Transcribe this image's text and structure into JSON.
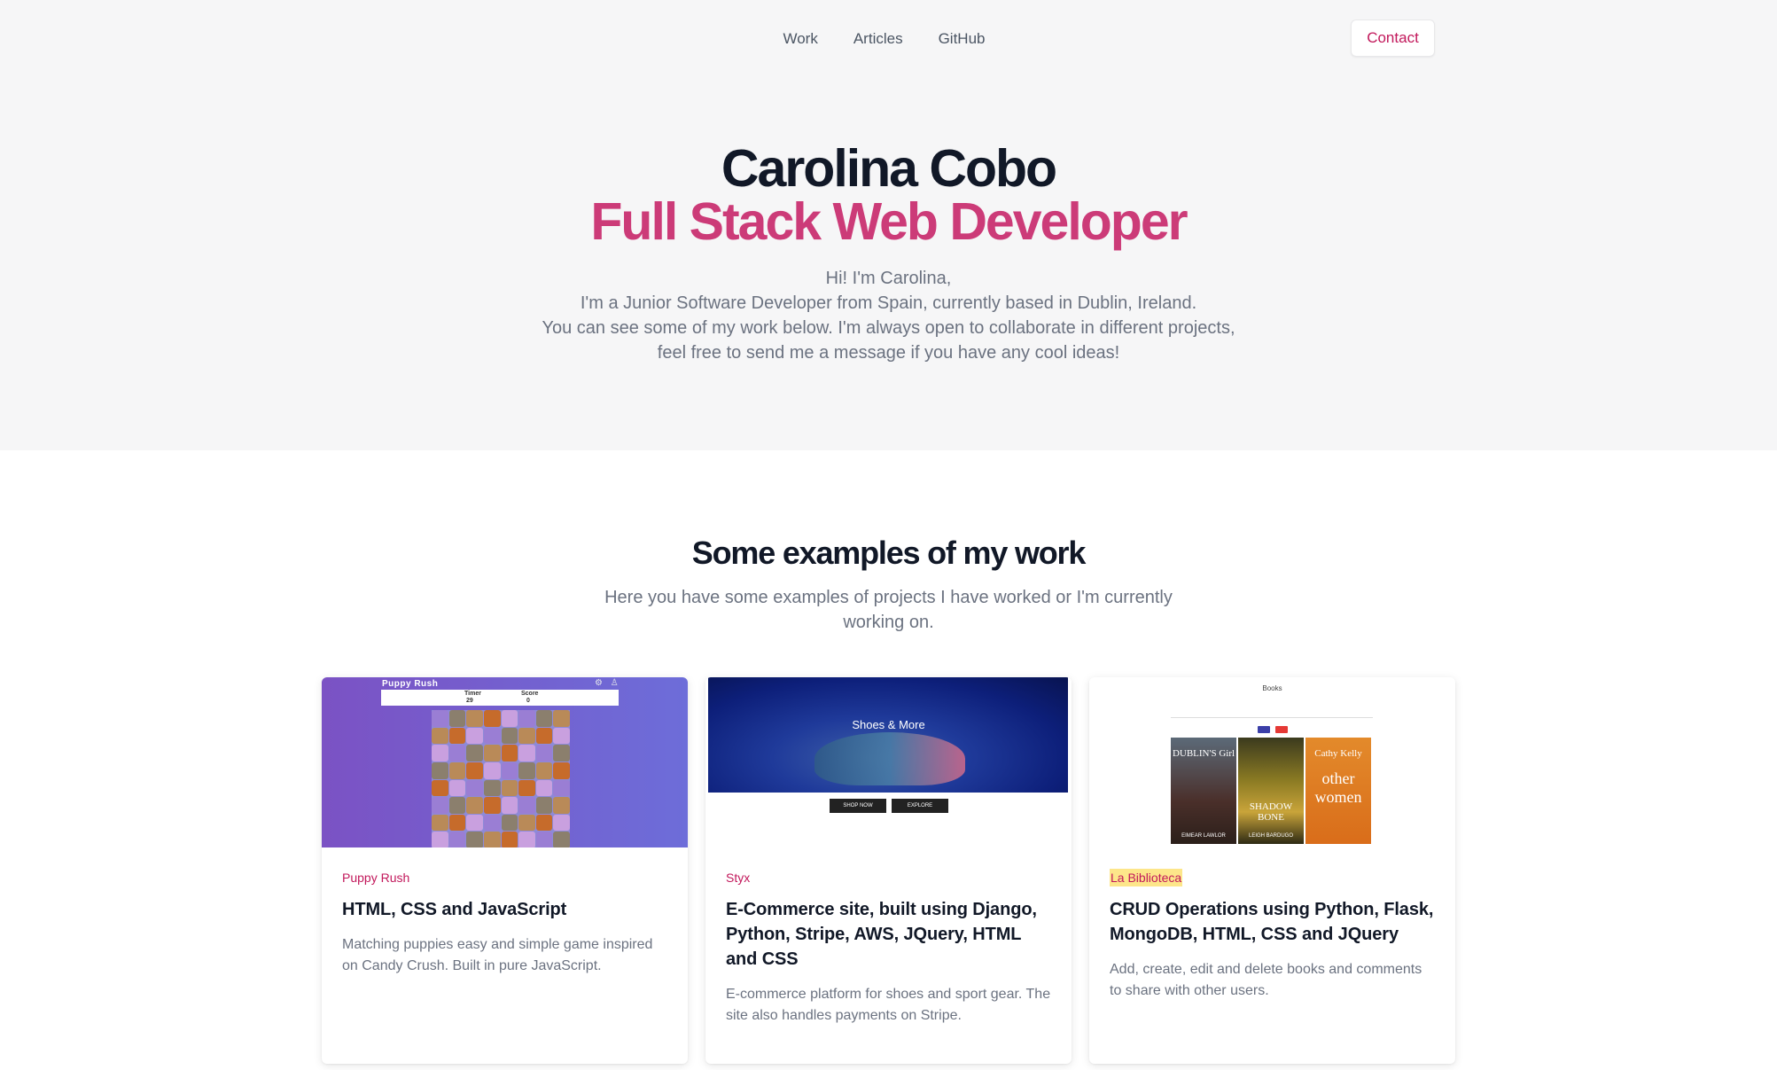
{
  "nav": {
    "links": [
      "Work",
      "Articles",
      "GitHub"
    ],
    "contact_label": "Contact"
  },
  "hero": {
    "name": "Carolina Cobo",
    "role": "Full Stack Web Developer",
    "bio_lines": [
      "Hi! I'm Carolina,",
      "I'm a Junior Software Developer from Spain, currently based in Dublin, Ireland.",
      "You can see some of my work below. I'm always open to collaborate in different projects,",
      "feel free to send me a message if you have any cool ideas!"
    ]
  },
  "work": {
    "title": "Some examples of my work",
    "subtitle_lines": [
      "Here you have some examples of projects I have worked or I'm currently",
      "working on."
    ]
  },
  "cards": [
    {
      "tag": "Puppy Rush",
      "title": "HTML, CSS and JavaScript",
      "description": "Matching puppies easy and simple game inspired on Candy Crush. Built in pure JavaScript.",
      "preview": {
        "title": "Puppy Rush",
        "timer_label": "Timer",
        "timer_value": "29",
        "score_label": "Score",
        "score_value": "0"
      }
    },
    {
      "tag": "Styx",
      "title": "E-Commerce site, built using Django, Python, Stripe, AWS, JQuery, HTML and CSS",
      "description": "E-commerce platform for shoes and sport gear. The site also handles payments on Stripe.",
      "preview": {
        "hero_text": "Shoes & More",
        "button_1": "SHOP NOW",
        "button_2": "EXPLORE"
      }
    },
    {
      "tag": "La Biblioteca",
      "title": "CRUD Operations using Python, Flask, MongoDB, HTML, CSS and JQuery",
      "description": "Add, create, edit and delete books and comments to share with other users.",
      "preview": {
        "header": "Books",
        "book_1_title": "DUBLIN'S Girl",
        "book_1_author": "EIMEAR LAWLOR",
        "book_2_title": "SHADOW BONE",
        "book_2_author": "LEIGH BARDUGO",
        "book_3_author": "Cathy Kelly",
        "book_3_title": "other women"
      }
    }
  ],
  "colors": {
    "accent": "#cc3b78",
    "tag": "#c2185b",
    "hero_bg": "#f6f6f7",
    "heading": "#111827",
    "body_text": "#6b7280"
  },
  "icons": {
    "puppy_settings": "gear-icon",
    "puppy_user": "user-icon"
  }
}
